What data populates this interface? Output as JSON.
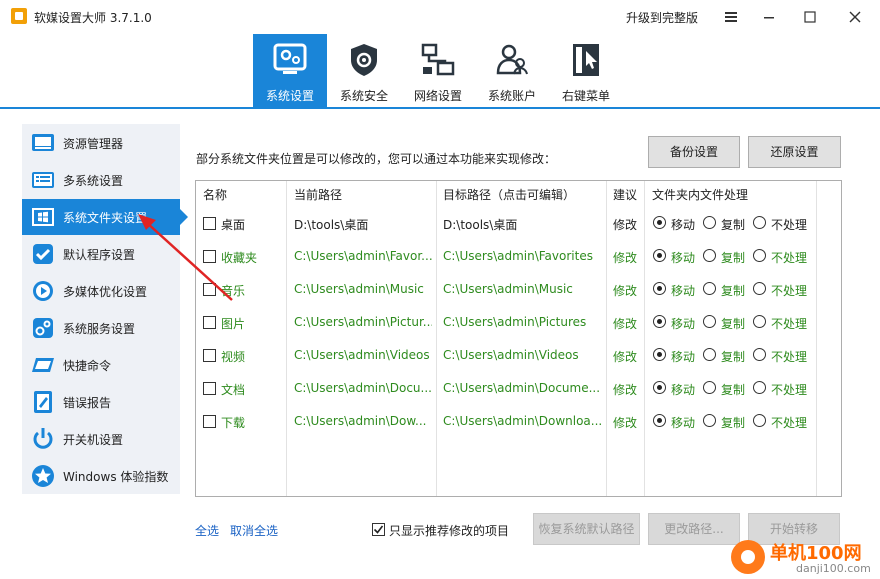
{
  "window": {
    "title": "软媒设置大师 3.7.1.0",
    "upgrade_label": "升级到完整版",
    "menu_icon": "hamburger-icon",
    "minimize_icon": "minimize-icon",
    "maximize_icon": "maximize-icon",
    "close_icon": "close-icon"
  },
  "topnav": {
    "tabs": [
      {
        "label": "系统设置",
        "icon": "monitor-gear-icon",
        "active": true
      },
      {
        "label": "系统安全",
        "icon": "shield-gear-icon",
        "active": false
      },
      {
        "label": "网络设置",
        "icon": "network-icon",
        "active": false
      },
      {
        "label": "系统账户",
        "icon": "users-icon",
        "active": false
      },
      {
        "label": "右键菜单",
        "icon": "cursor-menu-icon",
        "active": false
      }
    ]
  },
  "sidebar": {
    "items": [
      {
        "label": "资源管理器",
        "icon": "explorer-icon",
        "active": false
      },
      {
        "label": "多系统设置",
        "icon": "multi-system-icon",
        "active": false
      },
      {
        "label": "系统文件夹设置",
        "icon": "windows-folder-icon",
        "active": true
      },
      {
        "label": "默认程序设置",
        "icon": "default-program-icon",
        "active": false
      },
      {
        "label": "多媒体优化设置",
        "icon": "multimedia-icon",
        "active": false
      },
      {
        "label": "系统服务设置",
        "icon": "service-icon",
        "active": false
      },
      {
        "label": "快捷命令",
        "icon": "shortcut-command-icon",
        "active": false
      },
      {
        "label": "错误报告",
        "icon": "error-report-icon",
        "active": false
      },
      {
        "label": "开关机设置",
        "icon": "power-icon",
        "active": false
      },
      {
        "label": "Windows 体验指数",
        "icon": "experience-index-icon",
        "active": false
      }
    ]
  },
  "main": {
    "description": "部分系统文件夹位置是可以修改的，您可以通过本功能来实现修改：",
    "backup_label": "备份设置",
    "restore_label": "还原设置",
    "table": {
      "headers": {
        "name": "名称",
        "current": "当前路径",
        "target": "目标路径（点击可编辑）",
        "suggest": "建议",
        "handling": "文件夹内文件处理"
      },
      "rows": [
        {
          "name": "桌面",
          "current": "D:\\tools\\桌面",
          "target": "D:\\tools\\桌面",
          "suggest": "修改",
          "move": "移动",
          "copy": "复制",
          "none": "不处理",
          "highlight": false
        },
        {
          "name": "收藏夹",
          "current": "C:\\Users\\admin\\Favor...",
          "target": "C:\\Users\\admin\\Favorites",
          "suggest": "修改",
          "move": "移动",
          "copy": "复制",
          "none": "不处理",
          "highlight": true
        },
        {
          "name": "音乐",
          "current": "C:\\Users\\admin\\Music",
          "target": "C:\\Users\\admin\\Music",
          "suggest": "修改",
          "move": "移动",
          "copy": "复制",
          "none": "不处理",
          "highlight": true
        },
        {
          "name": "图片",
          "current": "C:\\Users\\admin\\Pictur...",
          "target": "C:\\Users\\admin\\Pictures",
          "suggest": "修改",
          "move": "移动",
          "copy": "复制",
          "none": "不处理",
          "highlight": true
        },
        {
          "name": "视频",
          "current": "C:\\Users\\admin\\Videos",
          "target": "C:\\Users\\admin\\Videos",
          "suggest": "修改",
          "move": "移动",
          "copy": "复制",
          "none": "不处理",
          "highlight": true
        },
        {
          "name": "文档",
          "current": "C:\\Users\\admin\\Docu...",
          "target": "C:\\Users\\admin\\Docume...",
          "suggest": "修改",
          "move": "移动",
          "copy": "复制",
          "none": "不处理",
          "highlight": true
        },
        {
          "name": "下载",
          "current": "C:\\Users\\admin\\Dow...",
          "target": "C:\\Users\\admin\\Downloa...",
          "suggest": "修改",
          "move": "移动",
          "copy": "复制",
          "none": "不处理",
          "highlight": true
        }
      ]
    },
    "select_all_label": "全选",
    "deselect_all_label": "取消全选",
    "only_recommended_label": "只显示推荐修改的项目",
    "only_recommended_checked": true,
    "restore_default_label": "恢复系统默认路径",
    "change_path_label": "更改路径...",
    "start_move_label": "开始转移"
  },
  "colors": {
    "accent": "#1a85d8",
    "highlight_text": "#2e8b1e",
    "link": "#1a62c4",
    "annotation_arrow": "#e02424"
  },
  "watermark": {
    "title": "单机100网",
    "url": "danji100.com"
  }
}
